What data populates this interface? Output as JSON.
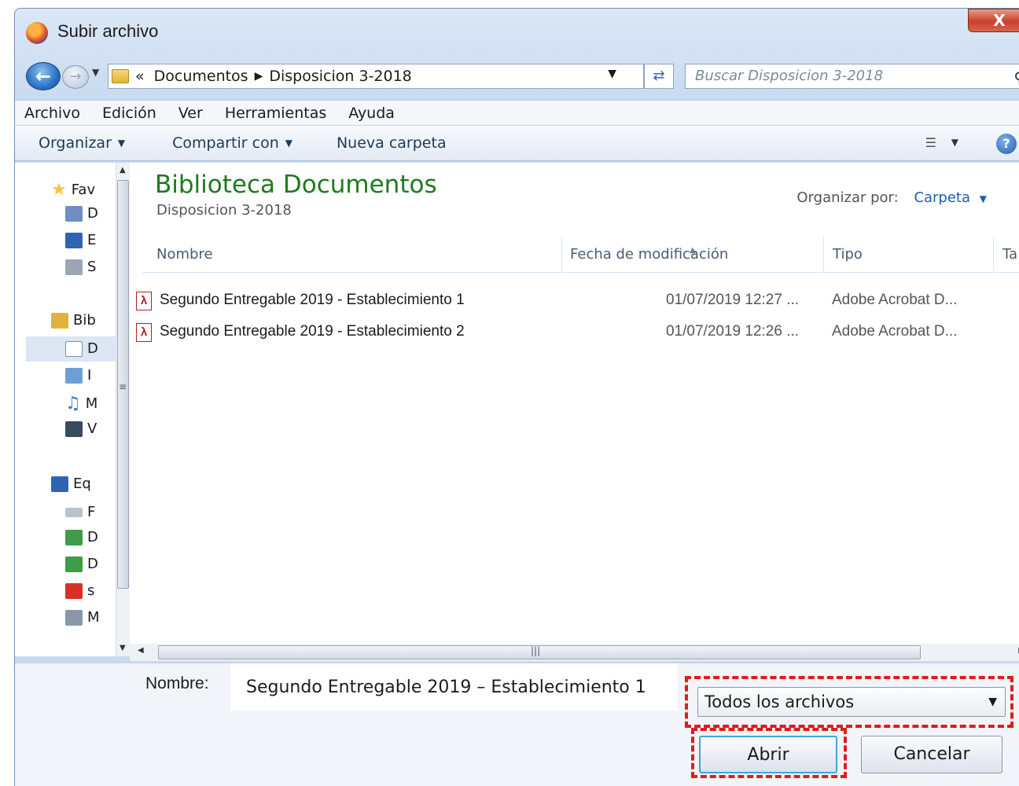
{
  "window": {
    "title": "Subir archivo",
    "close_label": "X"
  },
  "address": {
    "prefix": "«",
    "crumbs": [
      "Documentos",
      "Disposicion 3-2018"
    ],
    "search_placeholder": "Buscar Disposicion 3-2018"
  },
  "menu": [
    "Archivo",
    "Edición",
    "Ver",
    "Herramientas",
    "Ayuda"
  ],
  "toolbar": {
    "organize": "Organizar",
    "share": "Compartir con",
    "new_folder": "Nueva carpeta"
  },
  "navpane": {
    "items": [
      {
        "label": "Fav",
        "icon": "star-icon",
        "color": "#f5c542"
      },
      {
        "label": "D",
        "icon": "downloads-icon",
        "color": "#6d8fc4"
      },
      {
        "label": "E",
        "icon": "desktop-icon",
        "color": "#2f63b4"
      },
      {
        "label": "S",
        "icon": "recent-places-icon",
        "color": "#9aa6b6"
      },
      {
        "label": "Bib",
        "icon": "libraries-icon",
        "color": "#e2b23c"
      },
      {
        "label": "D",
        "icon": "documents-icon",
        "color": "#cfe0f2"
      },
      {
        "label": "I",
        "icon": "pictures-icon",
        "color": "#6d9fd6"
      },
      {
        "label": "M",
        "icon": "music-icon",
        "color": "#2f7fd6"
      },
      {
        "label": "V",
        "icon": "videos-icon",
        "color": "#3a4a60"
      },
      {
        "label": "Eq",
        "icon": "computer-icon",
        "color": "#2f63b4"
      },
      {
        "label": "F",
        "icon": "drive-icon",
        "color": "#b9c2cc"
      },
      {
        "label": "D",
        "icon": "network-drive-icon",
        "color": "#3e9c4a"
      },
      {
        "label": "D",
        "icon": "network-drive-icon",
        "color": "#3e9c4a"
      },
      {
        "label": "s",
        "icon": "disconnected-drive-icon",
        "color": "#d93025"
      },
      {
        "label": "M",
        "icon": "device-icon",
        "color": "#8a97a8"
      }
    ]
  },
  "library": {
    "title": "Biblioteca Documentos",
    "subtitle": "Disposicion 3-2018",
    "arrange_label": "Organizar por:",
    "arrange_value": "Carpeta"
  },
  "columns": {
    "name": "Nombre",
    "date": "Fecha de modificación",
    "type": "Tipo",
    "size": "Ta"
  },
  "files": [
    {
      "name": "Segundo Entregable 2019 - Establecimiento 1",
      "date": "01/07/2019 12:27 ...",
      "type": "Adobe Acrobat D..."
    },
    {
      "name": "Segundo Entregable 2019 - Establecimiento 2",
      "date": "01/07/2019 12:26 ...",
      "type": "Adobe Acrobat D..."
    }
  ],
  "footer": {
    "name_label": "Nombre:",
    "name_value": "Segundo Entregable 2019 – Establecimiento 1",
    "filter_value": "Todos los archivos",
    "open_label": "Abrir",
    "cancel_label": "Cancelar"
  },
  "colors": {
    "library_title": "#1e7a1e",
    "highlight": "#e01b1b",
    "link": "#1f5fb0"
  }
}
